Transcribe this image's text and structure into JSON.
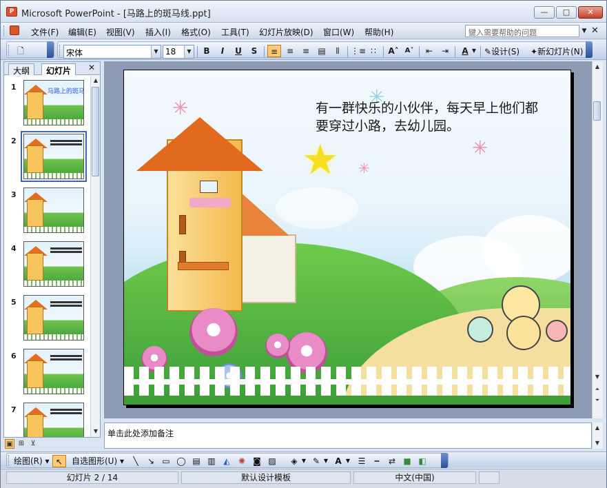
{
  "window": {
    "title": "Microsoft PowerPoint - [马路上的斑马线.ppt]",
    "min_symbol": "—",
    "max_symbol": "□",
    "close_symbol": "✕"
  },
  "menu": {
    "items": [
      "文件(F)",
      "编辑(E)",
      "视图(V)",
      "插入(I)",
      "格式(O)",
      "工具(T)",
      "幻灯片放映(D)",
      "窗口(W)",
      "帮助(H)"
    ],
    "help_placeholder": "键入需要帮助的问题",
    "doc_close": "✕"
  },
  "toolbar": {
    "font_name": "宋体",
    "font_size": "18",
    "bold": "B",
    "italic": "I",
    "underline": "U",
    "shadow": "S",
    "design_label": "设计(S)",
    "new_slide_label": "新幻灯片(N)",
    "icons": [
      "new-doc-icon",
      "align-left-icon",
      "align-center-icon",
      "align-right-icon",
      "distributed-icon",
      "vertical-text-icon",
      "numbering-icon",
      "bullets-icon",
      "increase-font-icon",
      "decrease-font-icon",
      "decrease-indent-icon",
      "increase-indent-icon",
      "font-color-icon"
    ]
  },
  "left_pane": {
    "tab_outline": "大纲",
    "tab_slides": "幻灯片",
    "close": "✕",
    "thumbnails": [
      {
        "num": "1",
        "title": "马路上的斑马线"
      },
      {
        "num": "2"
      },
      {
        "num": "3"
      },
      {
        "num": "4"
      },
      {
        "num": "5"
      },
      {
        "num": "6"
      },
      {
        "num": "7"
      }
    ],
    "selected_index": 2
  },
  "slide": {
    "text": "有一群快乐的小伙伴，每天早上他们都要穿过小路，去幼儿园。"
  },
  "notes": {
    "placeholder": "单击此处添加备注"
  },
  "drawing_toolbar": {
    "draw_label": "绘图(R)",
    "autoshapes_label": "自选图形(U)"
  },
  "status": {
    "slide_info": "幻灯片 2 / 14",
    "template": "默认设计模板",
    "language": "中文(中国)"
  },
  "colors": {
    "accent_orange": "#ffc978",
    "titlebar": "#d6e1f0",
    "toolbar_blue": "#bfd0e8"
  }
}
